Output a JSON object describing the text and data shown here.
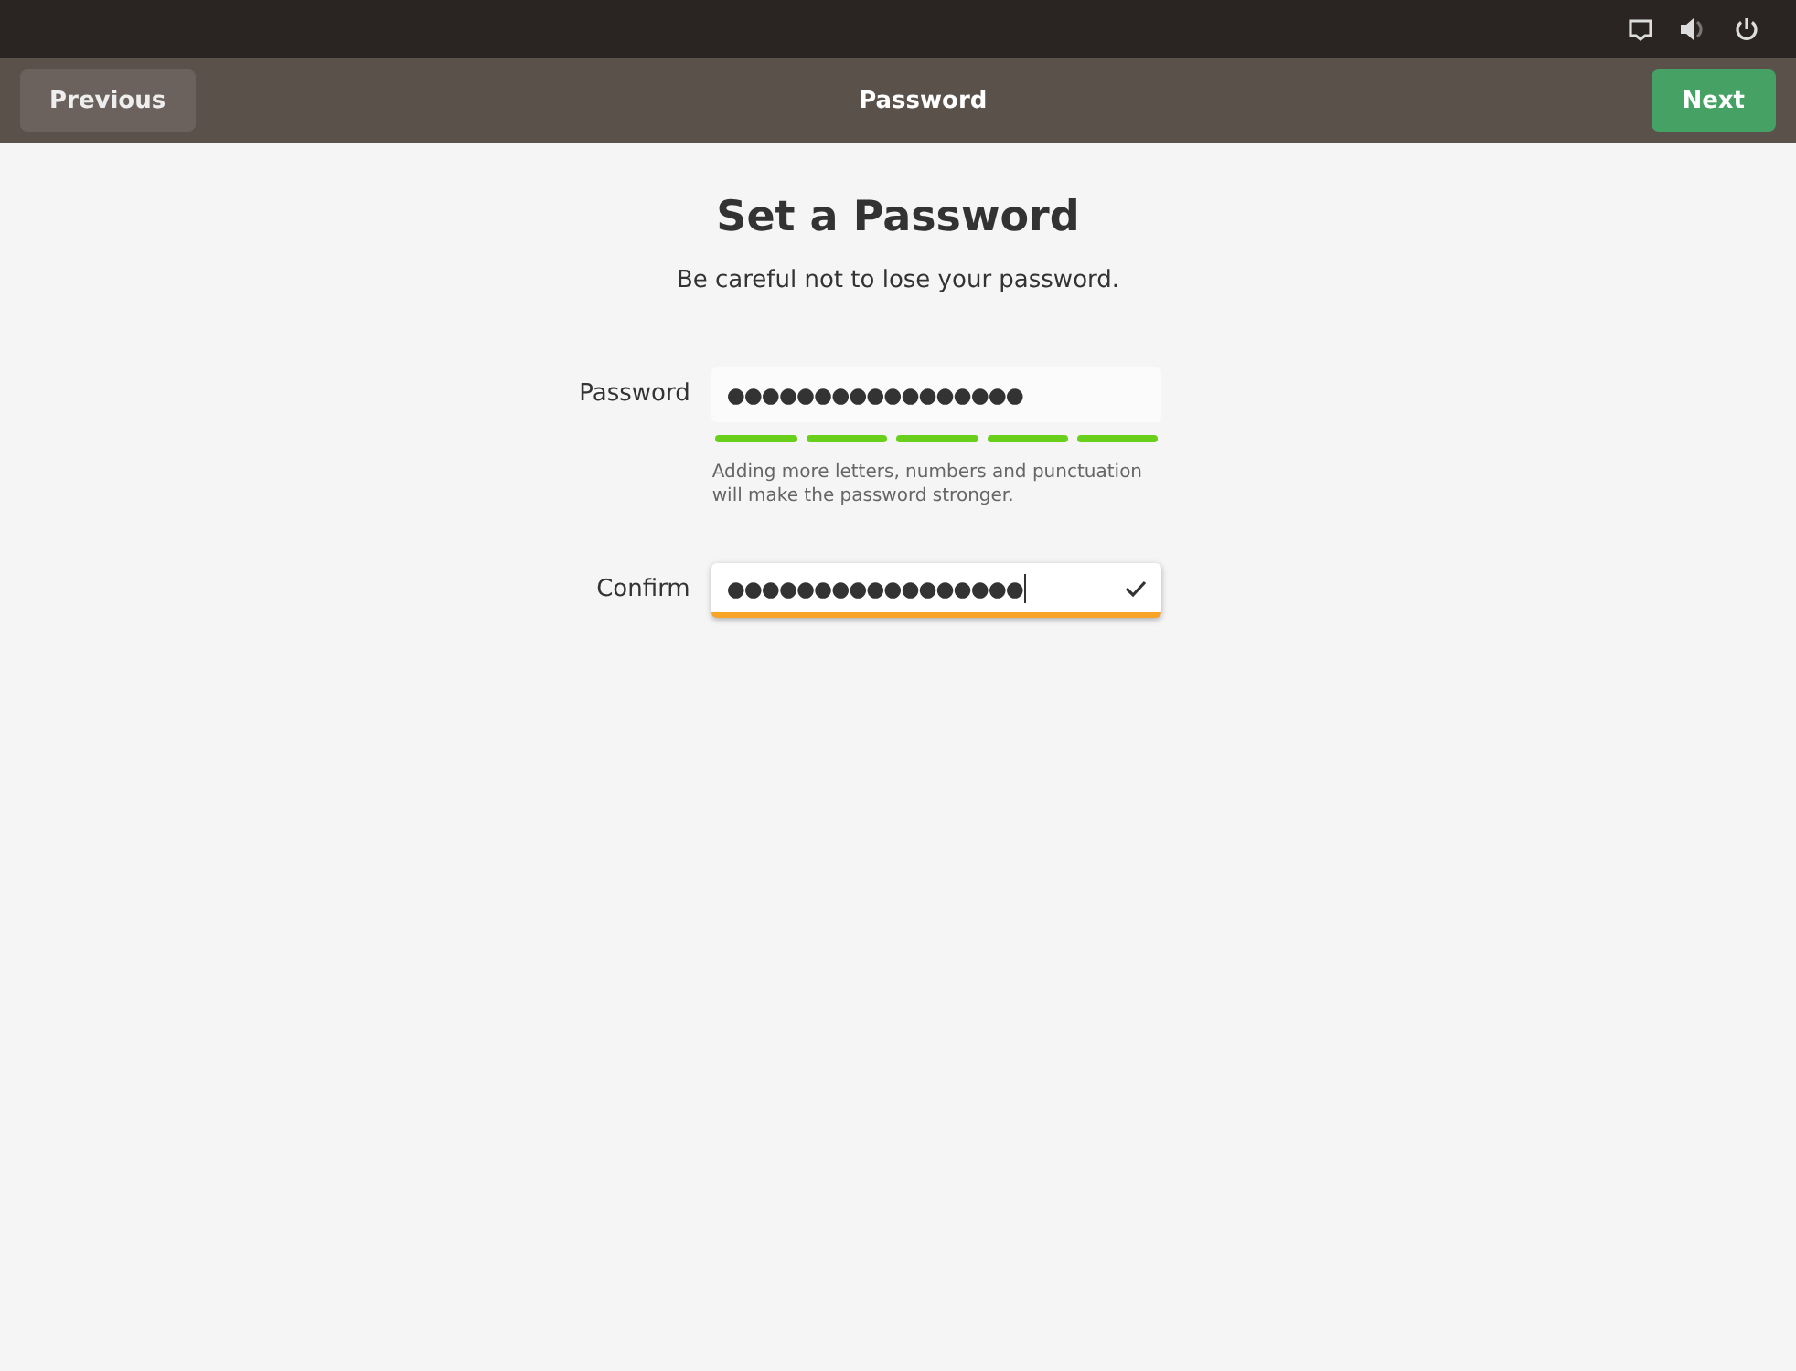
{
  "header": {
    "title": "Password",
    "back_button": "Previous",
    "next_button": "Next"
  },
  "heading": "Set a Password",
  "subtitle": "Be careful not to lose your password.",
  "fields": [
    {
      "label": "Password",
      "value": "●●●●●●●●●●●●●●●●●",
      "focused": false,
      "strength": [
        {
          "on": true
        },
        {
          "on": true
        },
        {
          "on": true
        },
        {
          "on": true
        },
        {
          "on": true
        }
      ],
      "hint": "Adding more letters, numbers and punctuation will make the password stronger."
    },
    {
      "label": "Confirm",
      "value": "●●●●●●●●●●●●●●●●●",
      "focused": true,
      "matched": true
    }
  ]
}
